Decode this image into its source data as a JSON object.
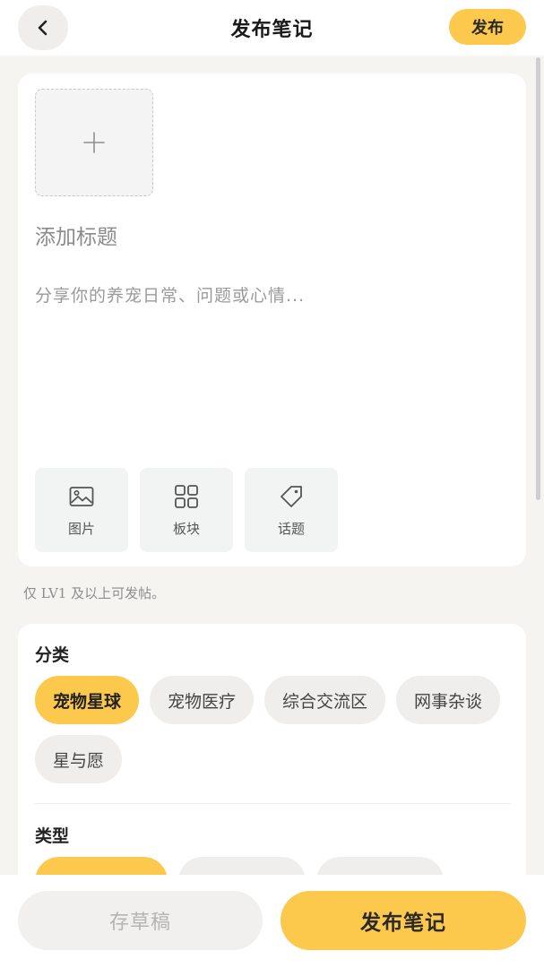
{
  "header": {
    "title": "发布笔记",
    "publish_label": "发布"
  },
  "editor": {
    "title_placeholder": "添加标题",
    "body_placeholder": "分享你的养宠日常、问题或心情...",
    "tools": [
      {
        "label": "图片",
        "icon": "image-icon"
      },
      {
        "label": "板块",
        "icon": "grid-icon"
      },
      {
        "label": "话题",
        "icon": "tag-icon"
      }
    ]
  },
  "hint": "仅 LV1 及以上可发帖。",
  "category": {
    "label": "分类",
    "chips": [
      {
        "label": "宠物星球",
        "active": true
      },
      {
        "label": "宠物医疗",
        "active": false
      },
      {
        "label": "综合交流区",
        "active": false
      },
      {
        "label": "网事杂谈",
        "active": false
      },
      {
        "label": "星与愿",
        "active": false
      }
    ]
  },
  "type": {
    "label": "类型"
  },
  "bottom": {
    "draft_label": "存草稿",
    "publish_label": "发布笔记"
  },
  "colors": {
    "accent": "#fcc94c",
    "background": "#f6f4f0",
    "chip_bg": "#efeeec"
  }
}
